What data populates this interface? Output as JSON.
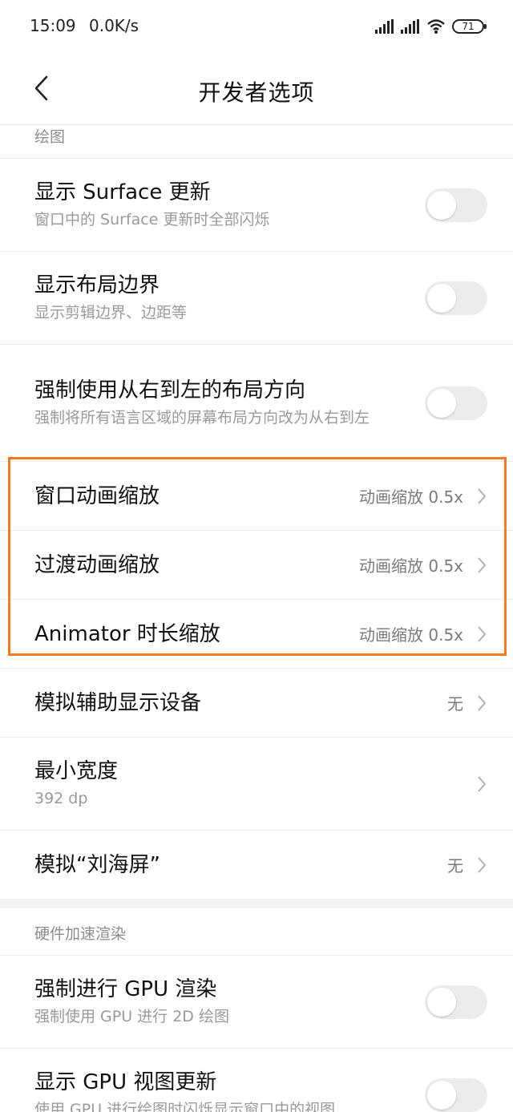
{
  "status_bar": {
    "time": "15:09",
    "speed": "0.0K/s",
    "battery": "71",
    "icons": [
      "signal-icon",
      "signal-icon",
      "wifi-icon",
      "battery-icon"
    ]
  },
  "header": {
    "title": "开发者选项",
    "back_icon": "chevron-left-icon"
  },
  "sections": {
    "drawing": {
      "header": "绘图",
      "items": [
        {
          "title": "显示 Surface 更新",
          "subtitle": "窗口中的 Surface 更新时全部闪烁",
          "toggle": false
        },
        {
          "title": "显示布局边界",
          "subtitle": "显示剪辑边界、边距等",
          "toggle": false
        },
        {
          "title": "强制使用从右到左的布局方向",
          "subtitle": "强制将所有语言区域的屏幕布局方向改为从右到左",
          "toggle": false
        },
        {
          "title": "窗口动画缩放",
          "value": "动画缩放 0.5x"
        },
        {
          "title": "过渡动画缩放",
          "value": "动画缩放 0.5x"
        },
        {
          "title": "Animator 时长缩放",
          "value": "动画缩放 0.5x"
        },
        {
          "title": "模拟辅助显示设备",
          "value": "无"
        },
        {
          "title": "最小宽度",
          "subtitle": "392 dp",
          "value": ""
        },
        {
          "title": "模拟“刘海屏”",
          "value": "无"
        }
      ]
    },
    "hw": {
      "header": "硬件加速渲染",
      "items": [
        {
          "title": "强制进行 GPU 渲染",
          "subtitle": "强制使用 GPU 进行 2D 绘图",
          "toggle": false
        },
        {
          "title": "显示 GPU 视图更新",
          "subtitle": "使用 GPU 进行绘图时闪烁显示窗口中的视图",
          "toggle": false
        }
      ]
    }
  },
  "colors": {
    "highlight": "#f47b20",
    "toggle_off": "#ebebeb",
    "section_gap": "#f2f2f2"
  }
}
